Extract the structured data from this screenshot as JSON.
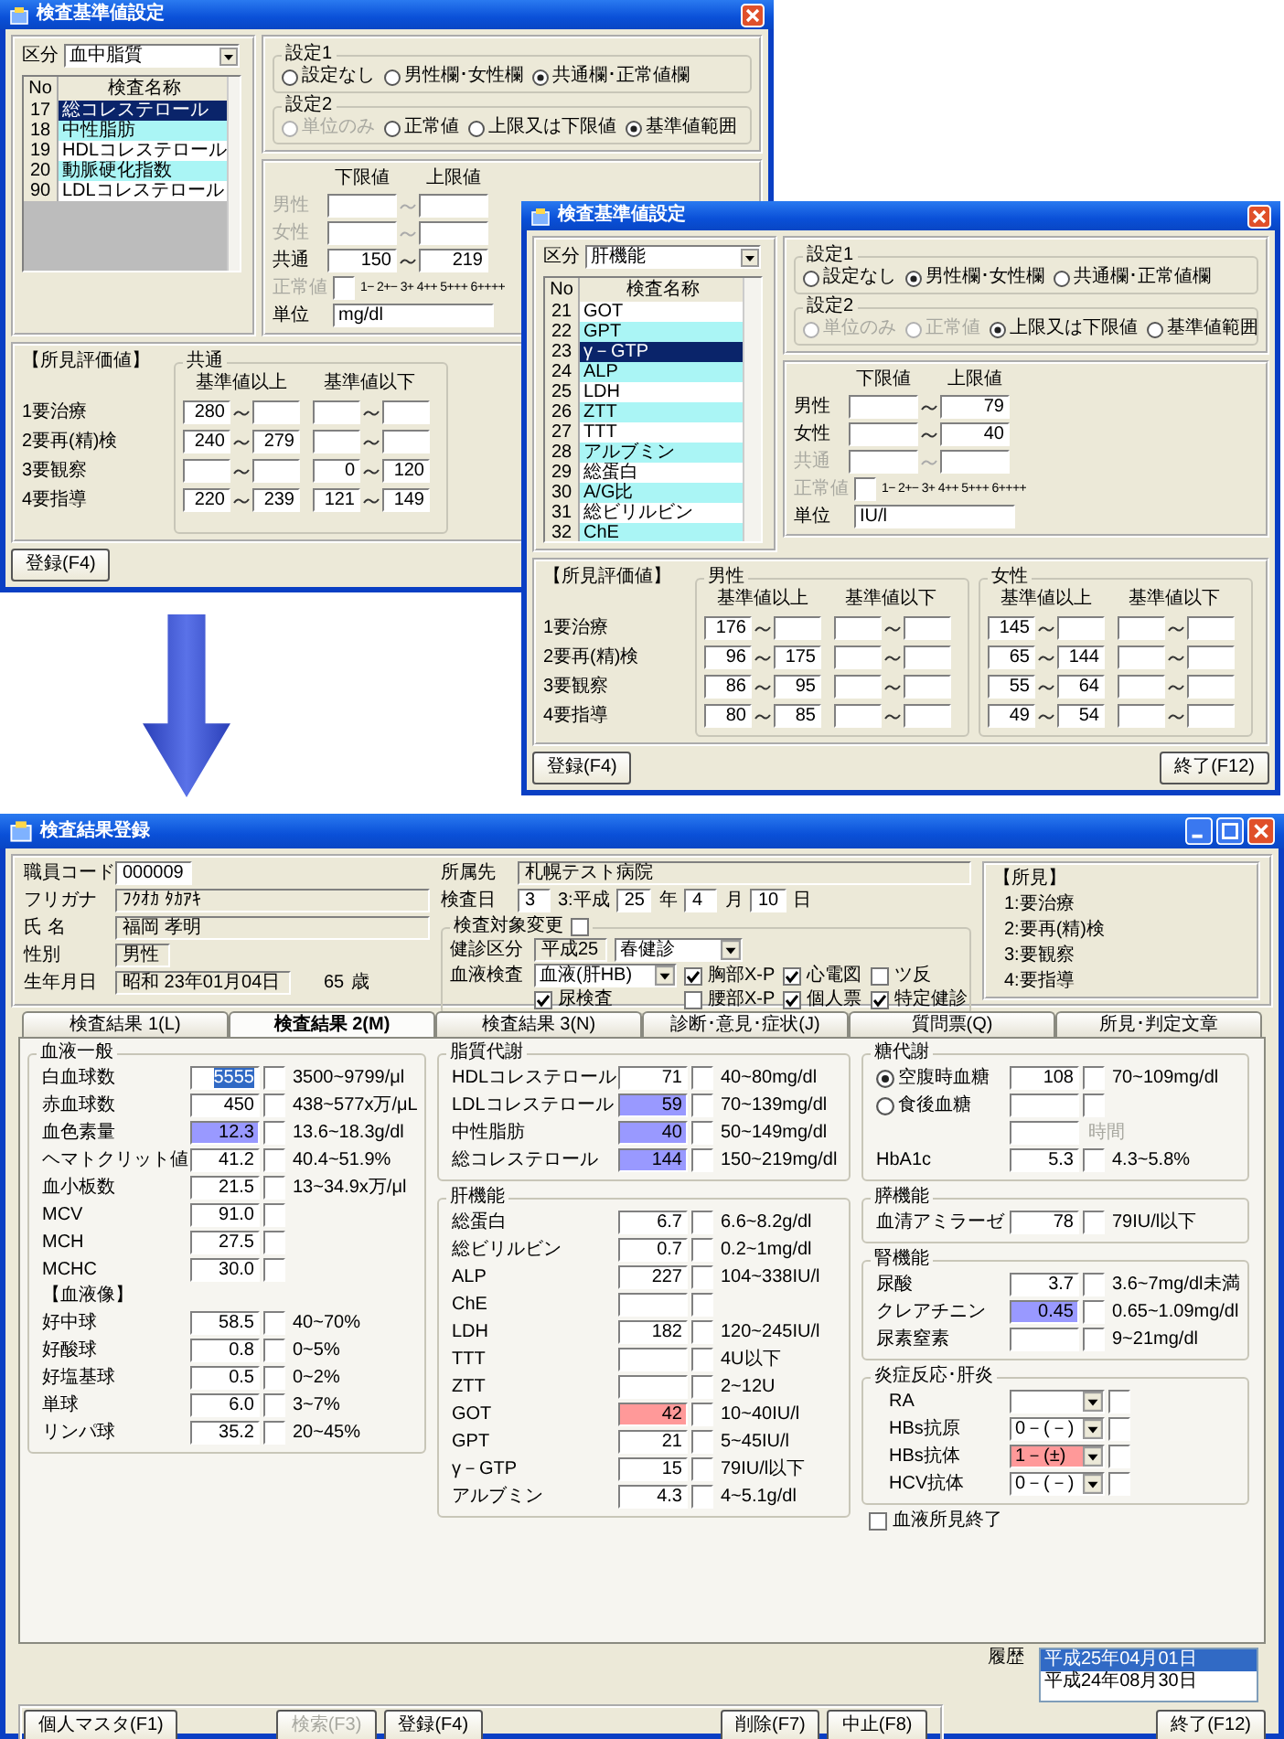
{
  "reference_windows": [
    {
      "title": "検査基準値設定",
      "category_label": "区分",
      "category": "血中脂質",
      "list": {
        "columns": [
          "No",
          "検査名称"
        ],
        "rows": [
          {
            "no": "17",
            "name": "総コレステロール",
            "selected": true
          },
          {
            "no": "18",
            "name": "中性脂肪",
            "selected": false
          },
          {
            "no": "19",
            "name": "HDLコレステロール",
            "selected": false
          },
          {
            "no": "20",
            "name": "動脈硬化指数",
            "selected": false
          },
          {
            "no": "90",
            "name": "LDLコレステロール",
            "selected": false
          }
        ]
      },
      "settings": [
        {
          "title": "設定1",
          "options": [
            {
              "label": "設定なし",
              "selected": false,
              "disabled": false
            },
            {
              "label": "男性欄･女性欄",
              "selected": false,
              "disabled": false
            },
            {
              "label": "共通欄･正常値欄",
              "selected": true,
              "disabled": false
            }
          ]
        },
        {
          "title": "設定2",
          "options": [
            {
              "label": "単位のみ",
              "selected": false,
              "disabled": true
            },
            {
              "label": "正常値",
              "selected": false,
              "disabled": false
            },
            {
              "label": "上限又は下限値",
              "selected": false,
              "disabled": false
            },
            {
              "label": "基準値範囲",
              "selected": true,
              "disabled": false
            }
          ]
        }
      ],
      "range": {
        "lower_heading": "下限値",
        "upper_heading": "上限値",
        "rows": [
          {
            "label": "男性",
            "disabled": true
          },
          {
            "label": "女性",
            "disabled": true
          },
          {
            "label": "共通",
            "disabled": false,
            "lower": "150",
            "upper": "219"
          }
        ],
        "normal_label": "正常値",
        "normal_disabled": true,
        "normal_scale": "1− 2+− 3+ 4++ 5+++ 6++++",
        "unit_label": "単位",
        "unit": "mg/dl"
      },
      "evaluation": {
        "title": "【所見評価値】",
        "levels": [
          "1要治療",
          "2要再(精)検",
          "3要観察",
          "4要指導"
        ],
        "groups": [
          {
            "title": "共通",
            "above_heading": "基準値以上",
            "below_heading": "基準値以下",
            "rows": [
              {
                "above_from": "280"
              },
              {
                "above_from": "240",
                "above_to": "279"
              },
              {
                "below_from": "0",
                "below_to": "120"
              },
              {
                "above_from": "220",
                "above_to": "239",
                "below_from": "121",
                "below_to": "149"
              }
            ]
          }
        ]
      },
      "buttons": [
        "登録(F4)"
      ]
    },
    {
      "title": "検査基準値設定",
      "category_label": "区分",
      "category": "肝機能",
      "list": {
        "columns": [
          "No",
          "検査名称"
        ],
        "rows": [
          {
            "no": "21",
            "name": "GOT",
            "selected": false
          },
          {
            "no": "22",
            "name": "GPT",
            "selected": false
          },
          {
            "no": "23",
            "name": "γ－GTP",
            "selected": true
          },
          {
            "no": "24",
            "name": "ALP",
            "selected": false
          },
          {
            "no": "25",
            "name": "LDH",
            "selected": false
          },
          {
            "no": "26",
            "name": "ZTT",
            "selected": false
          },
          {
            "no": "27",
            "name": "TTT",
            "selected": false
          },
          {
            "no": "28",
            "name": "アルブミン",
            "selected": false
          },
          {
            "no": "29",
            "name": "総蛋白",
            "selected": false
          },
          {
            "no": "30",
            "name": "A/G比",
            "selected": false
          },
          {
            "no": "31",
            "name": "総ビリルビン",
            "selected": false
          },
          {
            "no": "32",
            "name": "ChE",
            "selected": false
          }
        ]
      },
      "settings": [
        {
          "title": "設定1",
          "options": [
            {
              "label": "設定なし",
              "selected": false,
              "disabled": false
            },
            {
              "label": "男性欄･女性欄",
              "selected": true,
              "disabled": false
            },
            {
              "label": "共通欄･正常値欄",
              "selected": false,
              "disabled": false
            }
          ]
        },
        {
          "title": "設定2",
          "options": [
            {
              "label": "単位のみ",
              "selected": false,
              "disabled": true
            },
            {
              "label": "正常値",
              "selected": false,
              "disabled": true
            },
            {
              "label": "上限又は下限値",
              "selected": true,
              "disabled": false
            },
            {
              "label": "基準値範囲",
              "selected": false,
              "disabled": false
            }
          ]
        }
      ],
      "range": {
        "lower_heading": "下限値",
        "upper_heading": "上限値",
        "rows": [
          {
            "label": "男性",
            "disabled": false,
            "upper": "79"
          },
          {
            "label": "女性",
            "disabled": false,
            "upper": "40"
          },
          {
            "label": "共通",
            "disabled": true
          }
        ],
        "normal_label": "正常値",
        "normal_disabled": true,
        "normal_scale": "1− 2+− 3+ 4++ 5+++ 6++++",
        "unit_label": "単位",
        "unit": "IU/l"
      },
      "evaluation": {
        "title": "【所見評価値】",
        "levels": [
          "1要治療",
          "2要再(精)検",
          "3要観察",
          "4要指導"
        ],
        "groups": [
          {
            "title": "男性",
            "above_heading": "基準値以上",
            "below_heading": "基準値以下",
            "rows": [
              {
                "above_from": "176"
              },
              {
                "above_from": "96",
                "above_to": "175"
              },
              {
                "above_from": "86",
                "above_to": "95"
              },
              {
                "above_from": "80",
                "above_to": "85"
              }
            ]
          },
          {
            "title": "女性",
            "above_heading": "基準値以上",
            "below_heading": "基準値以下",
            "rows": [
              {
                "above_from": "145"
              },
              {
                "above_from": "65",
                "above_to": "144"
              },
              {
                "above_from": "55",
                "above_to": "64"
              },
              {
                "above_from": "49",
                "above_to": "54"
              }
            ]
          }
        ]
      },
      "buttons": [
        "登録(F4)",
        "終了(F12)"
      ]
    }
  ],
  "results_window": {
    "title": "検査結果登録",
    "person": [
      {
        "label": "職員コード",
        "value": "000009",
        "readonly": false
      },
      {
        "label": "フリガナ",
        "value": "ﾌｸｵｶ ﾀｶｱｷ",
        "readonly": true
      },
      {
        "label": "氏 名",
        "value": "福岡 孝明",
        "readonly": true
      },
      {
        "label": "性別",
        "value": "男性",
        "readonly": true
      },
      {
        "label": "生年月日",
        "value": "昭和 23年01月04日",
        "readonly": true
      }
    ],
    "age": "65",
    "age_unit": "歳",
    "affiliation": {
      "label": "所属先",
      "value": "札幌テスト病院"
    },
    "exam_date": {
      "label": "検査日",
      "era_code": "3",
      "era": "3:平成",
      "year": "25",
      "year_unit": "年",
      "month": "4",
      "month_unit": "月",
      "day": "10",
      "day_unit": "日"
    },
    "target_change": {
      "title": "検査対象変更",
      "checked": false,
      "checkup_label": "健診区分",
      "checkup_year": "平成25",
      "checkup_type": "春健診",
      "blood_label": "血液検査",
      "blood_type": "血液(肝HB)",
      "checks": [
        {
          "label": "胸部X-P",
          "checked": true
        },
        {
          "label": "心電図",
          "checked": true
        },
        {
          "label": "ツ反",
          "checked": false
        },
        {
          "label": "尿検査",
          "checked": true
        },
        {
          "label": "腰部X-P",
          "checked": false
        },
        {
          "label": "個人票",
          "checked": true
        },
        {
          "label": "特定健診",
          "checked": true
        }
      ]
    },
    "findings": {
      "title": "【所見】",
      "items": [
        "1:要治療",
        "2:要再(精)検",
        "3:要観察",
        "4:要指導"
      ]
    },
    "tabs": [
      {
        "label": "検査結果 1(L)",
        "selected": false
      },
      {
        "label": "検査結果 2(M)",
        "selected": true
      },
      {
        "label": "検査結果 3(N)",
        "selected": false
      },
      {
        "label": "診断･意見･症状(J)",
        "selected": false
      },
      {
        "label": "質問票(Q)",
        "selected": false
      },
      {
        "label": "所見･判定文章",
        "selected": false
      }
    ],
    "blood_general": {
      "title": "血液一般",
      "rows": [
        {
          "label": "白血球数",
          "value": "5555",
          "range": "3500~9799/μl",
          "text_selected": true
        },
        {
          "label": "赤血球数",
          "value": "450",
          "range": "438~577x万/μL",
          "text_selected": false
        },
        {
          "label": "血色素量",
          "value": "12.3",
          "range": "13.6~18.3g/dl",
          "color": "#9999ff",
          "text_selected": false
        },
        {
          "label": "ヘマトクリット値",
          "value": "41.2",
          "range": "40.4~51.9%",
          "text_selected": false
        },
        {
          "label": "血小板数",
          "value": "21.5",
          "range": "13~34.9x万/μl",
          "text_selected": false
        },
        {
          "label": "MCV",
          "value": "91.0",
          "text_selected": false
        },
        {
          "label": "MCH",
          "value": "27.5",
          "text_selected": false
        },
        {
          "label": "MCHC",
          "value": "30.0",
          "text_selected": false
        }
      ]
    },
    "blood_image": {
      "title": "【血液像】",
      "rows": [
        {
          "label": "好中球",
          "value": "58.5",
          "range": "40~70%"
        },
        {
          "label": "好酸球",
          "value": "0.8",
          "range": "0~5%"
        },
        {
          "label": "好塩基球",
          "value": "0.5",
          "range": "0~2%"
        },
        {
          "label": "単球",
          "value": "6.0",
          "range": "3~7%"
        },
        {
          "label": "リンパ球",
          "value": "35.2",
          "range": "20~45%"
        }
      ]
    },
    "lipid": {
      "title": "脂質代謝",
      "rows": [
        {
          "label": "HDLコレステロール",
          "value": "71",
          "range": "40~80mg/dl"
        },
        {
          "label": "LDLコレステロール",
          "value": "59",
          "range": "70~139mg/dl",
          "color": "#9999ff"
        },
        {
          "label": "中性脂肪",
          "value": "40",
          "range": "50~149mg/dl",
          "color": "#9999ff"
        },
        {
          "label": "総コレステロール",
          "value": "144",
          "range": "150~219mg/dl",
          "color": "#9999ff"
        }
      ]
    },
    "liver": {
      "title": "肝機能",
      "rows": [
        {
          "label": "総蛋白",
          "value": "6.7",
          "range": "6.6~8.2g/dl"
        },
        {
          "label": "総ビリルビン",
          "value": "0.7",
          "range": "0.2~1mg/dl"
        },
        {
          "label": "ALP",
          "value": "227",
          "range": "104~338IU/l"
        },
        {
          "label": "ChE"
        },
        {
          "label": "LDH",
          "value": "182",
          "range": "120~245IU/l"
        },
        {
          "label": "TTT",
          "range": "4U以下"
        },
        {
          "label": "ZTT",
          "range": "2~12U"
        },
        {
          "label": "GOT",
          "value": "42",
          "range": "10~40IU/l",
          "color": "#ff9999"
        },
        {
          "label": "GPT",
          "value": "21",
          "range": "5~45IU/l"
        },
        {
          "label": "γ－GTP",
          "value": "15",
          "range": "79IU/l以下"
        },
        {
          "label": "アルブミン",
          "value": "4.3",
          "range": "4~5.1g/dl"
        }
      ]
    },
    "sugar": {
      "title": "糖代謝",
      "rows": [
        {
          "kind": "radio",
          "label": "空腹時血糖",
          "selected": true,
          "value": "108",
          "range": "70~109mg/dl"
        },
        {
          "kind": "radio",
          "label": "食後血糖",
          "selected": false
        },
        {
          "kind": "hours",
          "unit": "時間"
        },
        {
          "kind": "measure",
          "label": "HbA1c",
          "value": "5.3",
          "range": "4.3~5.8%"
        }
      ]
    },
    "pancreas": {
      "title": "膵機能",
      "rows": [
        {
          "label": "血清アミラーゼ",
          "value": "78",
          "range": "79IU/l以下"
        }
      ]
    },
    "kidney": {
      "title": "腎機能",
      "rows": [
        {
          "label": "尿酸",
          "value": "3.7",
          "range": "3.6~7mg/dl未満"
        },
        {
          "label": "クレアチニン",
          "value": "0.45",
          "range": "0.65~1.09mg/dl",
          "color": "#9999ff"
        },
        {
          "label": "尿素窒素",
          "range": "9~21mg/dl"
        }
      ]
    },
    "inflammation": {
      "title": "炎症反応･肝炎",
      "rows": [
        {
          "kind": "select",
          "label": "RA"
        },
        {
          "kind": "select",
          "label": "HBs抗原",
          "value": "0－(－)"
        },
        {
          "kind": "select",
          "label": "HBs抗体",
          "value": "1－(±)",
          "color": "#ff9999"
        },
        {
          "kind": "select",
          "label": "HCV抗体",
          "value": "0－(－)"
        }
      ]
    },
    "blood_done": {
      "label": "血液所見終了",
      "checked": false
    },
    "history": {
      "label": "履歴",
      "items": [
        {
          "text": "平成25年04月01日",
          "selected": true
        },
        {
          "text": "平成24年08月30日",
          "selected": false
        }
      ]
    },
    "buttons": [
      {
        "label": "個人マスタ(F1)",
        "disabled": false
      },
      {
        "label": "検索(F3)",
        "disabled": true
      },
      {
        "label": "登録(F4)",
        "disabled": false
      },
      {
        "label": "削除(F7)",
        "disabled": false
      },
      {
        "label": "中止(F8)",
        "disabled": false
      },
      {
        "label": "終了(F12)",
        "disabled": false
      }
    ]
  }
}
